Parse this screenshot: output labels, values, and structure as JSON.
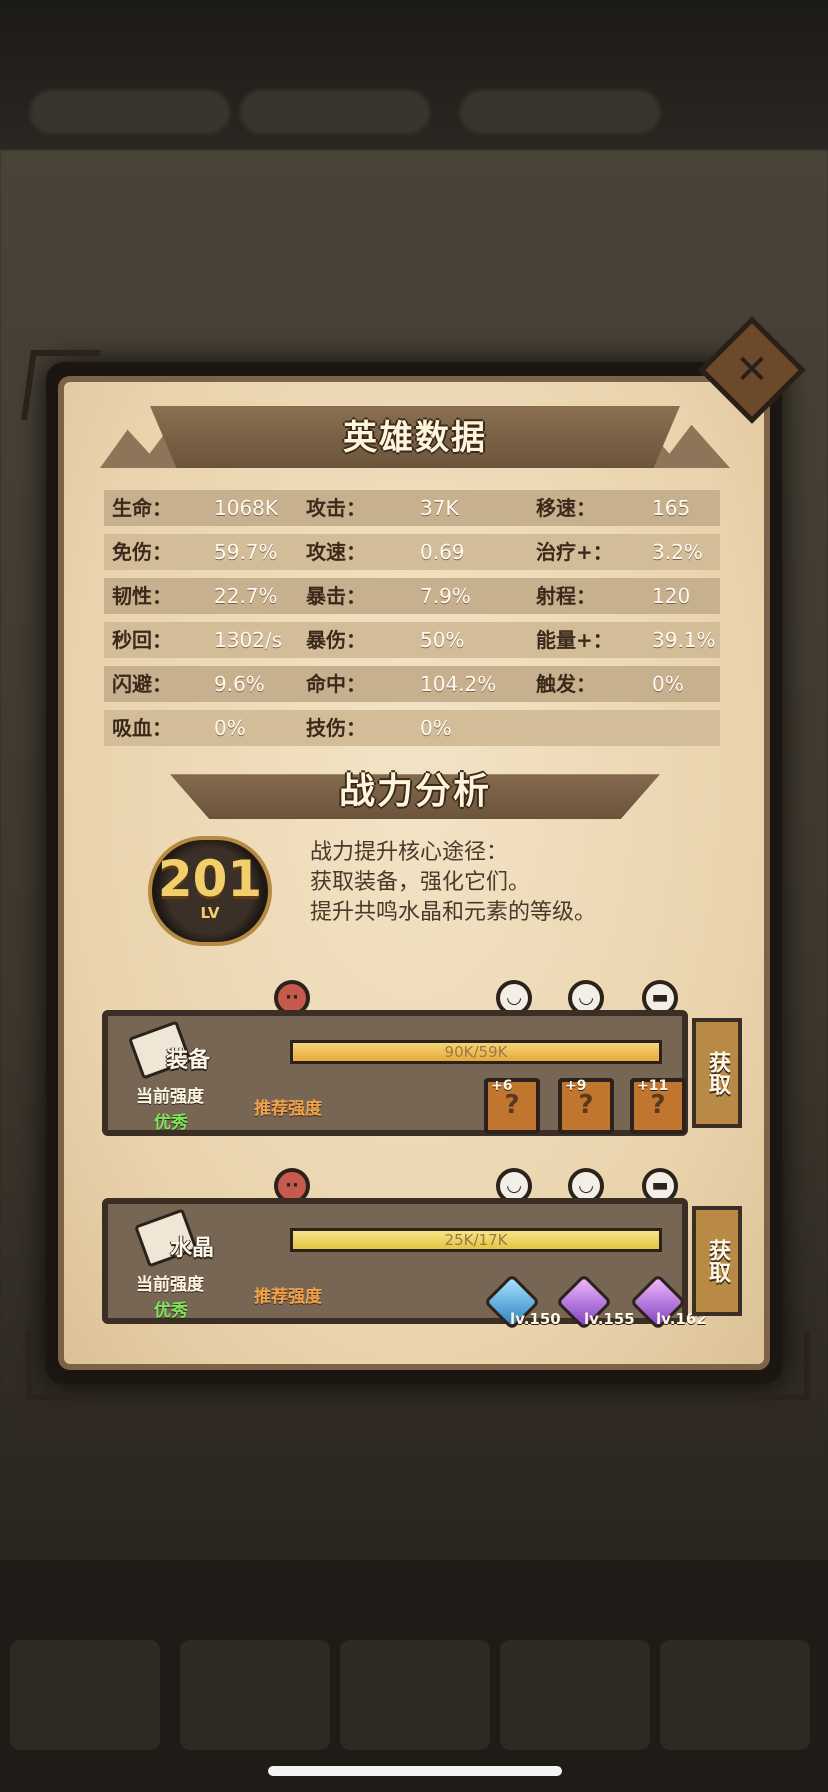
{
  "modal": {
    "title": "英雄数据",
    "close_label": "✕",
    "stats": [
      [
        {
          "label": "生命：",
          "value": "1068K"
        },
        {
          "label": "攻击：",
          "value": "37K"
        },
        {
          "label": "移速：",
          "value": "165"
        }
      ],
      [
        {
          "label": "免伤：",
          "value": "59.7%"
        },
        {
          "label": "攻速：",
          "value": "0.69"
        },
        {
          "label": "治疗+：",
          "value": "3.2%"
        }
      ],
      [
        {
          "label": "韧性：",
          "value": "22.7%"
        },
        {
          "label": "暴击：",
          "value": "7.9%"
        },
        {
          "label": "射程：",
          "value": "120"
        }
      ],
      [
        {
          "label": "秒回：",
          "value": "1302/s"
        },
        {
          "label": "暴伤：",
          "value": "50%"
        },
        {
          "label": "能量+：",
          "value": "39.1%"
        }
      ],
      [
        {
          "label": "闪避：",
          "value": "9.6%"
        },
        {
          "label": "命中：",
          "value": "104.2%"
        },
        {
          "label": "触发：",
          "value": "0%"
        }
      ],
      [
        {
          "label": "吸血：",
          "value": "0%"
        },
        {
          "label": "技伤：",
          "value": "0%"
        }
      ]
    ],
    "analysis_title": "战力分析",
    "level": {
      "number": "201",
      "label": "LV"
    },
    "tips": [
      "战力提升核心途径：",
      "获取装备，强化它们。",
      "提升共鸣水晶和元素的等级。"
    ],
    "equipment": {
      "name": "装备",
      "progress_text": "90K/59K",
      "progress_fraction": 1.0,
      "current_label": "当前强度",
      "current_value": "优秀",
      "recommend_label": "推荐强度",
      "get_label": "获取",
      "slots": [
        "+6",
        "+9",
        "+11"
      ],
      "slot_glyph": "?"
    },
    "crystal": {
      "name": "水晶",
      "progress_text": "25K/17K",
      "progress_fraction": 1.0,
      "current_label": "当前强度",
      "current_value": "优秀",
      "recommend_label": "推荐强度",
      "get_label": "获取",
      "gems": [
        {
          "lv": "lv.150",
          "color": "blue"
        },
        {
          "lv": "lv.155",
          "color": "purple"
        },
        {
          "lv": "lv.162",
          "color": "purple"
        }
      ]
    },
    "faces": {
      "angry": "··",
      "smile": "◡",
      "grin": "◡",
      "cool": "▬"
    }
  },
  "colors": {
    "accent": "#e8a93a",
    "good": "#7ee35a",
    "recommend": "#f0a24a"
  }
}
